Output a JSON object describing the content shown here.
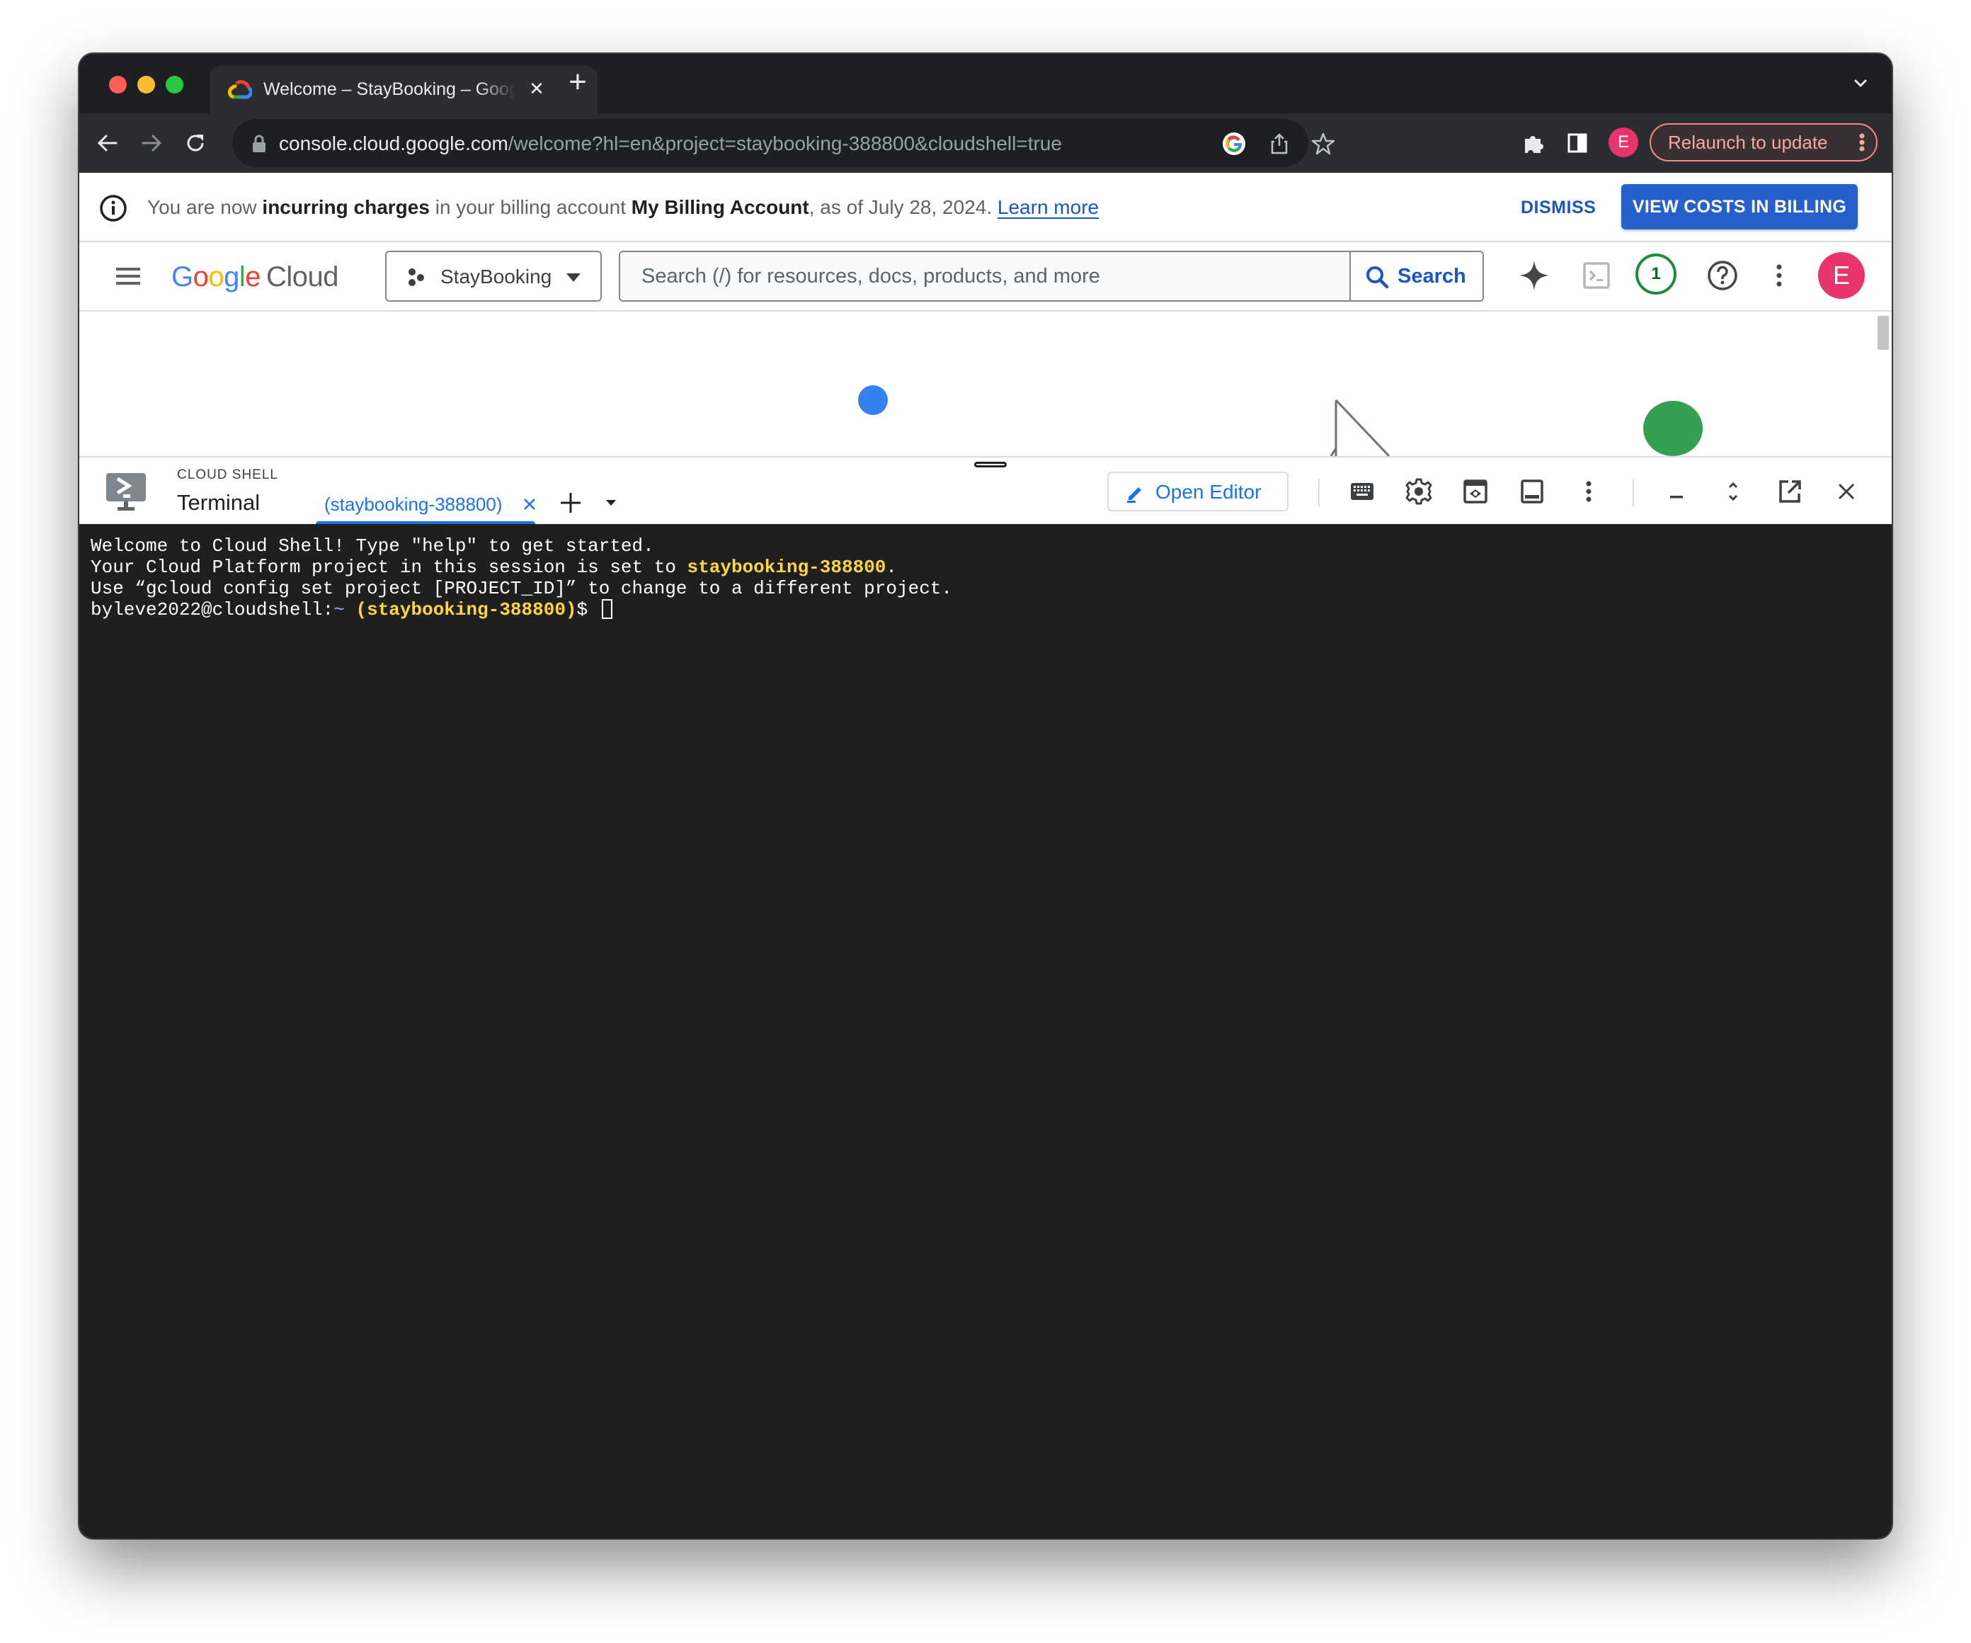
{
  "browser": {
    "tab": {
      "title": "Welcome – StayBooking – Google Cloud console",
      "favicon": "google-cloud-icon",
      "close_icon": "close-icon"
    },
    "new_tab_icon": "plus-icon",
    "tab_list_icon": "chevron-down-icon",
    "nav": {
      "back_icon": "arrow-left-icon",
      "forward_icon": "arrow-right-icon",
      "reload_icon": "reload-icon"
    },
    "url": {
      "host": "console.cloud.google.com",
      "path": "/welcome?hl=en&project=staybooking-388800&cloudshell=true"
    },
    "profile_initial": "E",
    "relaunch_label": "Relaunch to update"
  },
  "banner": {
    "segments": [
      {
        "text": "You are now ",
        "bold": false
      },
      {
        "text": "incurring charges",
        "bold": true
      },
      {
        "text": " in your billing account ",
        "bold": false
      },
      {
        "text": "My Billing Account",
        "bold": true
      },
      {
        "text": ", as of July 28, 2024. ",
        "bold": false
      }
    ],
    "link": "Learn more",
    "dismiss_label": "DISMISS",
    "view_costs_label": "VIEW COSTS IN BILLING"
  },
  "header": {
    "logo": {
      "google": [
        "G",
        "o",
        "o",
        "g",
        "l",
        "e"
      ],
      "product": "Cloud"
    },
    "project": "StayBooking",
    "search_placeholder": "Search (/) for resources, docs, products, and more",
    "search_value": "",
    "search_button": "Search",
    "notification_count": "1",
    "account_initial": "E"
  },
  "cloud_shell": {
    "kicker": "CLOUD SHELL",
    "title": "Terminal",
    "tabs": [
      {
        "label": "(staybooking-388800)",
        "active": true
      }
    ],
    "open_editor_label": "Open Editor",
    "toolbar_icons": [
      "keyboard-icon",
      "settings-icon",
      "web-preview-icon",
      "panel-layout-icon",
      "more-vert-icon"
    ],
    "window_icons": [
      "minimize-icon",
      "resize-icon",
      "open-in-new-window-icon",
      "close-icon"
    ]
  },
  "terminal": {
    "lines": [
      {
        "parts": [
          {
            "text": "Welcome to Cloud Shell! Type \"help\" to get started.",
            "style": "plain"
          }
        ]
      },
      {
        "parts": [
          {
            "text": "Your Cloud Platform project in this session is set to ",
            "style": "plain"
          },
          {
            "text": "staybooking-388800",
            "style": "highlight"
          },
          {
            "text": ".",
            "style": "plain"
          }
        ]
      },
      {
        "parts": [
          {
            "text": "Use “gcloud config set project [PROJECT_ID]” to change to a different project.",
            "style": "plain"
          }
        ]
      },
      {
        "parts": [
          {
            "text": "byleve2022@cloudshell:",
            "style": "plain"
          },
          {
            "text": "~",
            "style": "tilde"
          },
          {
            "text": " ",
            "style": "plain"
          },
          {
            "text": "(staybooking-388800)",
            "style": "highlight"
          },
          {
            "text": "$ ",
            "style": "plain"
          }
        ],
        "cursor": true
      }
    ]
  },
  "colors": {
    "accent_blue": "#1a73e8",
    "primary_button": "#2560cc",
    "avatar_pink": "#e8336b",
    "notification_green": "#1e8e3e",
    "terminal_bg": "#1f1f1f",
    "terminal_highlight": "#fcd53f",
    "relaunch_text": "#f4a9a4"
  }
}
